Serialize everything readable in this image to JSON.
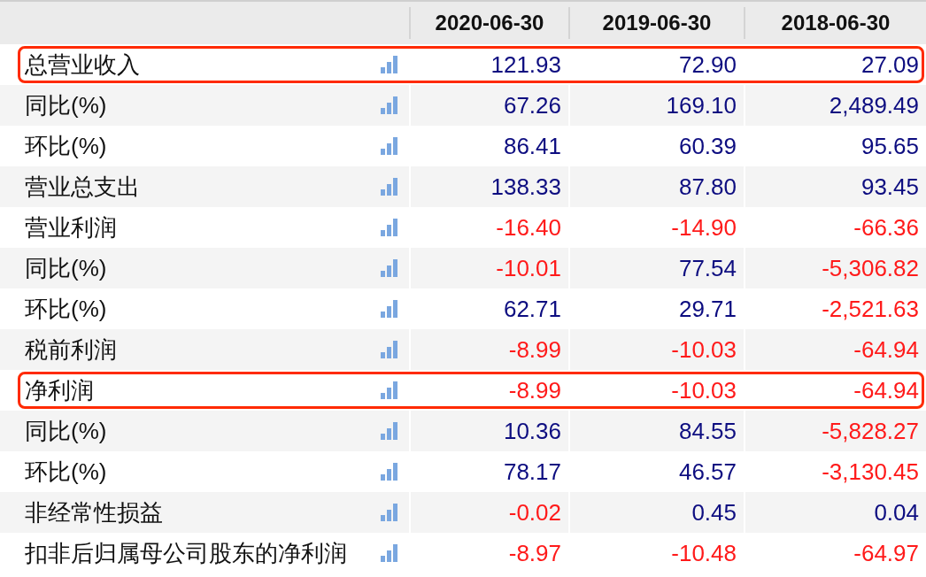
{
  "table": {
    "columns": [
      "2020-06-30",
      "2019-06-30",
      "2018-06-30"
    ],
    "rows": [
      {
        "label": "总营业收入",
        "highlighted": true,
        "cells": [
          {
            "value": "121.93",
            "negative": false
          },
          {
            "value": "72.90",
            "negative": false
          },
          {
            "value": "27.09",
            "negative": false
          }
        ]
      },
      {
        "label": "同比(%)",
        "highlighted": false,
        "cells": [
          {
            "value": "67.26",
            "negative": false
          },
          {
            "value": "169.10",
            "negative": false
          },
          {
            "value": "2,489.49",
            "negative": false
          }
        ]
      },
      {
        "label": "环比(%)",
        "highlighted": false,
        "cells": [
          {
            "value": "86.41",
            "negative": false
          },
          {
            "value": "60.39",
            "negative": false
          },
          {
            "value": "95.65",
            "negative": false
          }
        ]
      },
      {
        "label": "营业总支出",
        "highlighted": false,
        "cells": [
          {
            "value": "138.33",
            "negative": false
          },
          {
            "value": "87.80",
            "negative": false
          },
          {
            "value": "93.45",
            "negative": false
          }
        ]
      },
      {
        "label": "营业利润",
        "highlighted": false,
        "cells": [
          {
            "value": "-16.40",
            "negative": true
          },
          {
            "value": "-14.90",
            "negative": true
          },
          {
            "value": "-66.36",
            "negative": true
          }
        ]
      },
      {
        "label": "同比(%)",
        "highlighted": false,
        "cells": [
          {
            "value": "-10.01",
            "negative": true
          },
          {
            "value": "77.54",
            "negative": false
          },
          {
            "value": "-5,306.82",
            "negative": true
          }
        ]
      },
      {
        "label": "环比(%)",
        "highlighted": false,
        "cells": [
          {
            "value": "62.71",
            "negative": false
          },
          {
            "value": "29.71",
            "negative": false
          },
          {
            "value": "-2,521.63",
            "negative": true
          }
        ]
      },
      {
        "label": "税前利润",
        "highlighted": false,
        "cells": [
          {
            "value": "-8.99",
            "negative": true
          },
          {
            "value": "-10.03",
            "negative": true
          },
          {
            "value": "-64.94",
            "negative": true
          }
        ]
      },
      {
        "label": "净利润",
        "highlighted": true,
        "cells": [
          {
            "value": "-8.99",
            "negative": true
          },
          {
            "value": "-10.03",
            "negative": true
          },
          {
            "value": "-64.94",
            "negative": true
          }
        ]
      },
      {
        "label": "同比(%)",
        "highlighted": false,
        "cells": [
          {
            "value": "10.36",
            "negative": false
          },
          {
            "value": "84.55",
            "negative": false
          },
          {
            "value": "-5,828.27",
            "negative": true
          }
        ]
      },
      {
        "label": "环比(%)",
        "highlighted": false,
        "cells": [
          {
            "value": "78.17",
            "negative": false
          },
          {
            "value": "46.57",
            "negative": false
          },
          {
            "value": "-3,130.45",
            "negative": true
          }
        ]
      },
      {
        "label": "非经常性损益",
        "highlighted": false,
        "cells": [
          {
            "value": "-0.02",
            "negative": true
          },
          {
            "value": "0.45",
            "negative": false
          },
          {
            "value": "0.04",
            "negative": false
          }
        ]
      },
      {
        "label": "扣非后归属母公司股东的净利润",
        "highlighted": false,
        "cells": [
          {
            "value": "-8.97",
            "negative": true
          },
          {
            "value": "-10.48",
            "negative": true
          },
          {
            "value": "-64.97",
            "negative": true
          }
        ]
      }
    ]
  }
}
